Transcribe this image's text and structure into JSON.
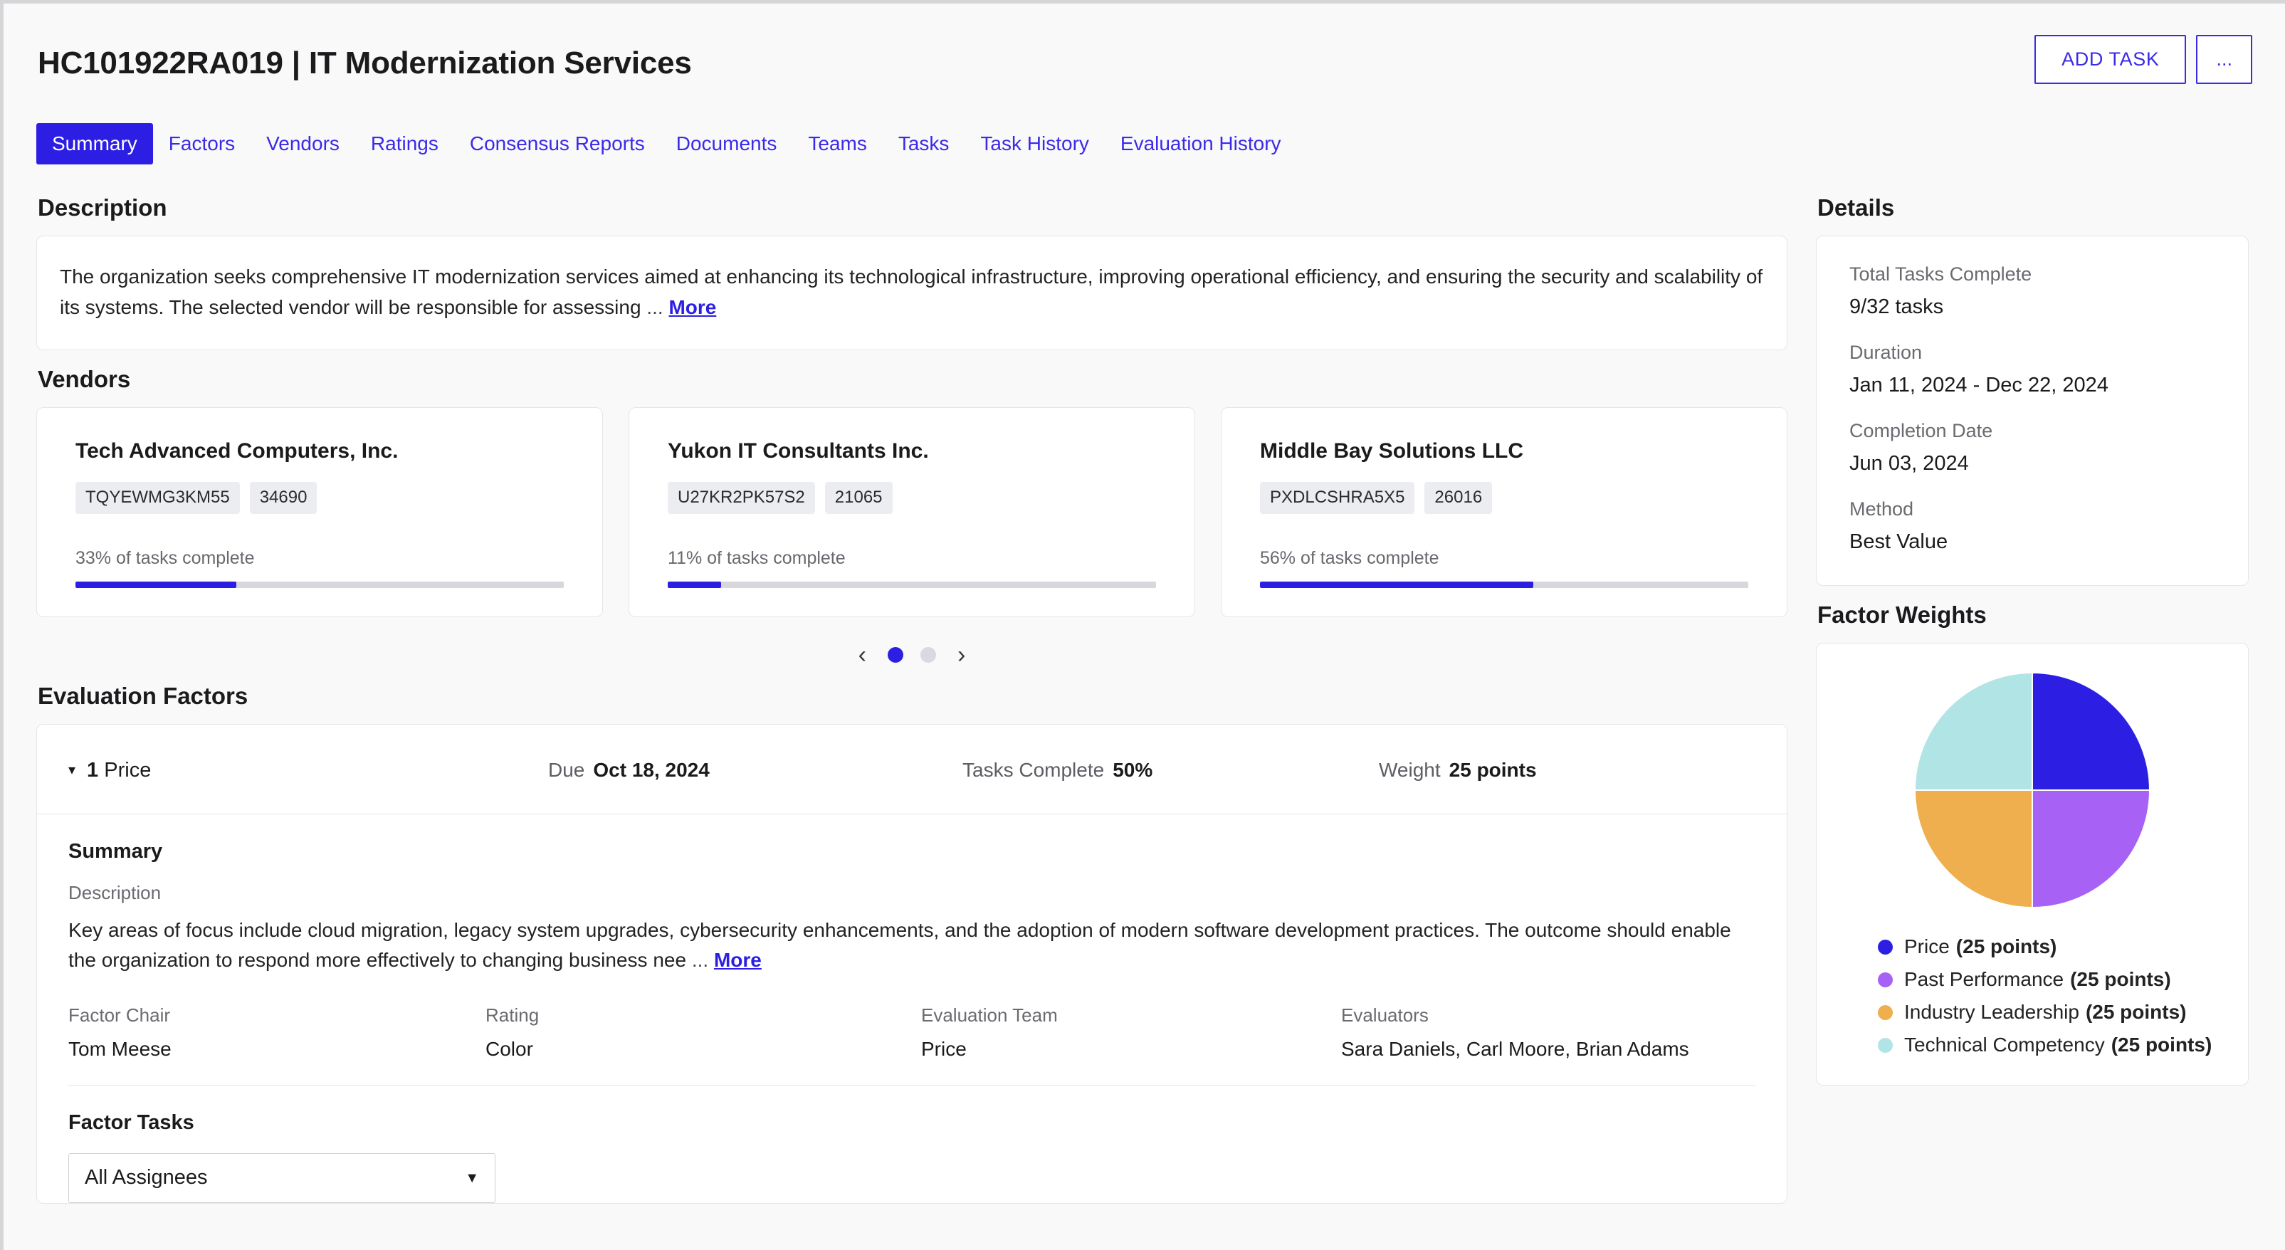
{
  "header": {
    "title": "HC101922RA019 | IT Modernization Services",
    "add_task_label": "ADD TASK",
    "more_actions_label": "..."
  },
  "tabs": [
    {
      "label": "Summary",
      "active": true
    },
    {
      "label": "Factors",
      "active": false
    },
    {
      "label": "Vendors",
      "active": false
    },
    {
      "label": "Ratings",
      "active": false
    },
    {
      "label": "Consensus Reports",
      "active": false
    },
    {
      "label": "Documents",
      "active": false
    },
    {
      "label": "Teams",
      "active": false
    },
    {
      "label": "Tasks",
      "active": false
    },
    {
      "label": "Task History",
      "active": false
    },
    {
      "label": "Evaluation History",
      "active": false
    }
  ],
  "description": {
    "heading": "Description",
    "text": "The organization seeks comprehensive IT modernization services aimed at enhancing its technological infrastructure, improving operational efficiency, and ensuring the security and scalability of its systems. The selected vendor will be responsible for assessing",
    "ellipsis": "...",
    "more_label": "More"
  },
  "vendors": {
    "heading": "Vendors",
    "cards": [
      {
        "name": "Tech Advanced Computers, Inc.",
        "code": "TQYEWMG3KM55",
        "number": "34690",
        "progress_label": "33% of tasks complete",
        "progress_percent": 33
      },
      {
        "name": "Yukon IT Consultants Inc.",
        "code": "U27KR2PK57S2",
        "number": "21065",
        "progress_label": "11% of tasks complete",
        "progress_percent": 11
      },
      {
        "name": "Middle Bay Solutions LLC",
        "code": "PXDLCSHRA5X5",
        "number": "26016",
        "progress_label": "56% of tasks complete",
        "progress_percent": 56
      }
    ],
    "carousel": {
      "prev_label": "‹",
      "next_label": "›",
      "dots": 2,
      "active_dot": 0
    }
  },
  "evaluation_factors": {
    "heading": "Evaluation Factors",
    "factor": {
      "index": "1",
      "name": "Price",
      "caret": "▾",
      "due_label": "Due",
      "due_value": "Oct 18, 2024",
      "tasks_complete_label": "Tasks Complete",
      "tasks_complete_value": "50%",
      "weight_label": "Weight",
      "weight_value": "25 points",
      "summary_heading": "Summary",
      "description_label": "Description",
      "description_text": "Key areas of focus include cloud migration, legacy system upgrades, cybersecurity enhancements, and the adoption of modern software development practices. The outcome should enable the organization to respond more effectively to changing business nee",
      "description_ellipsis": "...",
      "more_label": "More",
      "meta": [
        {
          "label": "Factor Chair",
          "value": "Tom Meese"
        },
        {
          "label": "Rating",
          "value": "Color"
        },
        {
          "label": "Evaluation Team",
          "value": "Price"
        },
        {
          "label": "Evaluators",
          "value": "Sara Daniels, Carl Moore, Brian Adams"
        }
      ],
      "tasks_heading": "Factor Tasks",
      "assignee_filter_value": "All Assignees",
      "assignee_filter_caret": "▼"
    }
  },
  "details": {
    "heading": "Details",
    "items": [
      {
        "label": "Total Tasks Complete",
        "value": "9/32 tasks"
      },
      {
        "label": "Duration",
        "value": "Jan 11, 2024 - Dec 22, 2024"
      },
      {
        "label": "Completion Date",
        "value": "Jun 03, 2024"
      },
      {
        "label": "Method",
        "value": "Best Value"
      }
    ]
  },
  "factor_weights": {
    "heading": "Factor Weights"
  },
  "chart_data": {
    "type": "pie",
    "title": "Factor Weights",
    "unit": "points",
    "total": 100,
    "legend_position": "bottom",
    "categories": [
      "Price",
      "Past Performance",
      "Industry Leadership",
      "Technical Competency"
    ],
    "values": [
      25,
      25,
      25,
      25
    ],
    "colors": [
      "#2c1fe3",
      "#a761f5",
      "#efaf4e",
      "#b1e4e5"
    ],
    "labels": [
      "Price (25 points)",
      "Past Performance (25 points)",
      "Industry Leadership (25 points)",
      "Technical Competency (25 points)"
    ],
    "legend": [
      {
        "name": "Price",
        "value_text": "(25 points)",
        "color": "#2c1fe3"
      },
      {
        "name": "Past Performance",
        "value_text": "(25 points)",
        "color": "#a761f5"
      },
      {
        "name": "Industry Leadership",
        "value_text": "(25 points)",
        "color": "#efaf4e"
      },
      {
        "name": "Technical Competency",
        "value_text": "(25 points)",
        "color": "#b1e4e5"
      }
    ],
    "start_angle_deg": 0,
    "direction": "clockwise"
  },
  "theme": {
    "accent": "#2c1fe3",
    "link": "#3b2ae8",
    "page_bg": "#f9f9fa",
    "card_bg": "#ffffff",
    "border": "#e6e6e9",
    "muted_text": "#6a6a70",
    "text": "#1b1b1d",
    "chip_bg": "#ecedf1",
    "progress_track": "#d8d8dc"
  }
}
